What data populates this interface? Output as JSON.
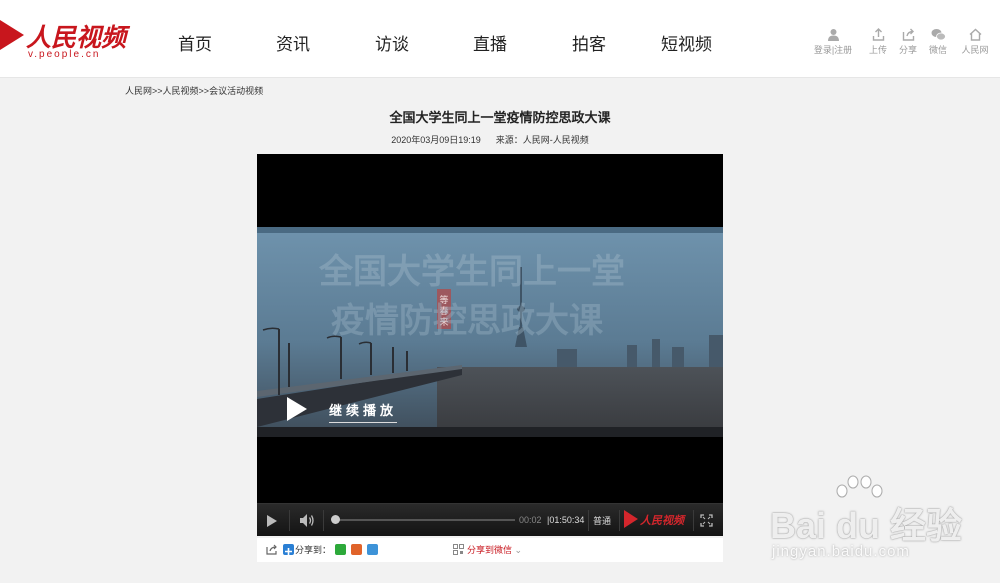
{
  "header": {
    "logo_text": "人民视频",
    "logo_sub": "v.people.cn",
    "nav": [
      "首页",
      "资讯",
      "访谈",
      "直播",
      "拍客",
      "短视频"
    ],
    "tools": {
      "login": "登录",
      "register": "注册",
      "separator": "|",
      "upload": "上传",
      "share": "分享",
      "wechat": "微信",
      "home": "人民网"
    }
  },
  "breadcrumb": {
    "items": [
      "人民网",
      "人民视频",
      "会议活动视频"
    ],
    "separator": ">>"
  },
  "article": {
    "title": "全国大学生同上一堂疫情防控思政大课",
    "datetime": "2020年03月09日19:19",
    "source_label": "来源：",
    "source": "人民网-人民视频"
  },
  "player": {
    "overlay_title_line1": "全国大学生同上一堂",
    "overlay_title_line2": "疫情防控思政大课",
    "stamp_text": "等春来",
    "resume_label": "继续播放",
    "current_time": "00:02",
    "total_time": "01:50:34",
    "quality": "普通",
    "brand": "人民视频",
    "progress": 0.0003
  },
  "share": {
    "label": "分享到：",
    "wechat_label": "分享到微信",
    "chevron": "⌄"
  },
  "watermark": {
    "main": "Bai du 经验",
    "sub": "jingyan.baidu.com"
  },
  "colors": {
    "brand_red": "#c8161d",
    "page_bg": "#f2f2f2",
    "player_bg": "#000000"
  }
}
